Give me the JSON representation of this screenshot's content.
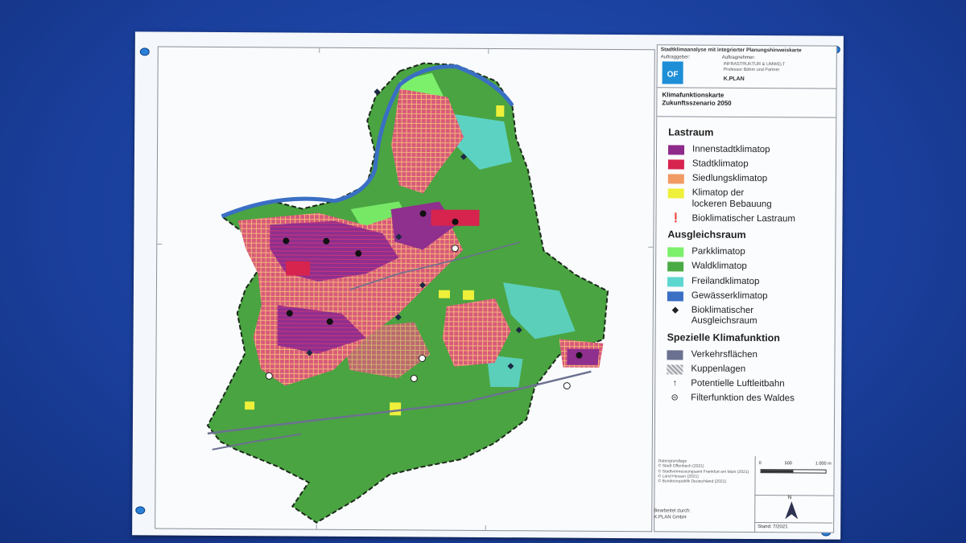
{
  "header": {
    "title": "Stadtklimaanalyse mit integrierter Planungshinweiskarte",
    "client_label": "Auftraggeber:",
    "contractor_label": "Auftragnehmer:",
    "client_logo_text": "OF",
    "contractor_1": "INFRASTRUKTUR & UMWELT",
    "contractor_1_sub": "Professor Böhm und Partner",
    "contractor_2": "K.PLAN"
  },
  "subtitle": {
    "line1": "Klimafunktionskarte",
    "line2": "Zukunftsszenario 2050"
  },
  "legend": {
    "lastraum": {
      "title": "Lastraum",
      "items": [
        {
          "label": "Innenstadtklimatop",
          "color": "#8e2a8a"
        },
        {
          "label": "Stadtklimatop",
          "color": "#d6244f"
        },
        {
          "label": "Siedlungsklimatop",
          "color": "#f29a64"
        },
        {
          "label": "Klimatop der lockeren Bebauung",
          "color": "#eef03a"
        }
      ],
      "symbol": {
        "label": "Bioklimatischer Lastraum",
        "icon": "exclamation-circle-icon"
      }
    },
    "ausgleichsraum": {
      "title": "Ausgleichsraum",
      "items": [
        {
          "label": "Parkklimatop",
          "color": "#7cf06a"
        },
        {
          "label": "Waldklimatop",
          "color": "#4aab44"
        },
        {
          "label": "Freilandklimatop",
          "color": "#5ed7d0"
        },
        {
          "label": "Gewässerklimatop",
          "color": "#3a6fc4"
        }
      ],
      "symbol": {
        "label": "Bioklimatischer Ausgleichsraum",
        "icon": "diamond-icon"
      }
    },
    "spezielle": {
      "title": "Spezielle Klimafunktion",
      "items": [
        {
          "label": "Verkehrsflächen",
          "icon": "road-swatch",
          "color": "#6b7190"
        },
        {
          "label": "Kuppenlagen",
          "icon": "hatched-swatch",
          "color": "#b9bcc2"
        },
        {
          "label": "Potentielle Luftleitbahn",
          "icon": "arrow-icon"
        },
        {
          "label": "Filterfunktion des Waldes",
          "icon": "filter-circle-icon"
        }
      ]
    }
  },
  "sources": {
    "title": "Datengrundlage",
    "lines": [
      "© Stadt Offenbach (2021)",
      "© Stadtvermessungsamt Frankfurt am Main (2021)",
      "© Land Hessen (2021)",
      "© Bundesrepublik Deutschland (2021)"
    ]
  },
  "scalebar": {
    "labels": [
      "0",
      "500",
      "1.000 m"
    ],
    "north": "N"
  },
  "stand": "Stand: 7/2021",
  "bearbeitet": {
    "label": "Bearbeitet durch:",
    "value": "K.PLAN GmbH"
  }
}
